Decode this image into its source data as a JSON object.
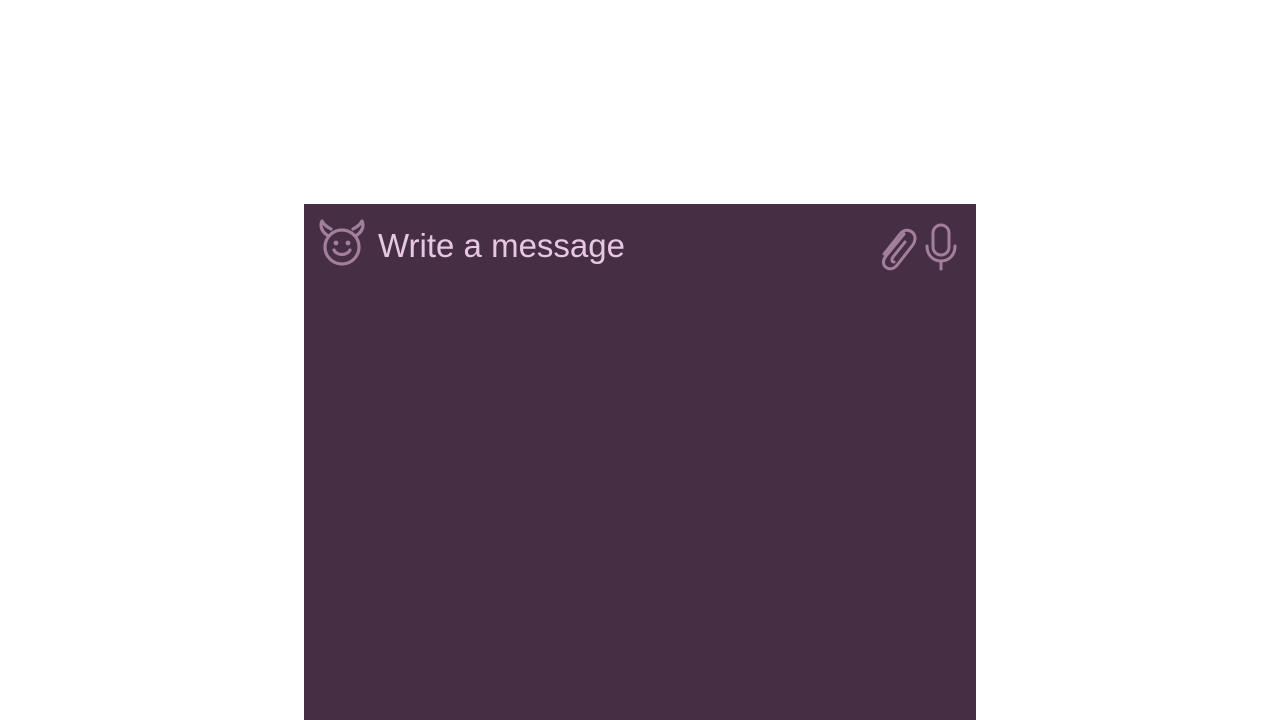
{
  "composer": {
    "placeholder": "Write a message",
    "value": "",
    "icons": {
      "emoji": "devil-smile-icon",
      "attach": "paperclip-icon",
      "voice": "microphone-icon"
    }
  },
  "colors": {
    "background": "#462e44",
    "icon": "#a27f9c",
    "placeholder_text": "#e7c7e1",
    "page": "#ffffff"
  }
}
